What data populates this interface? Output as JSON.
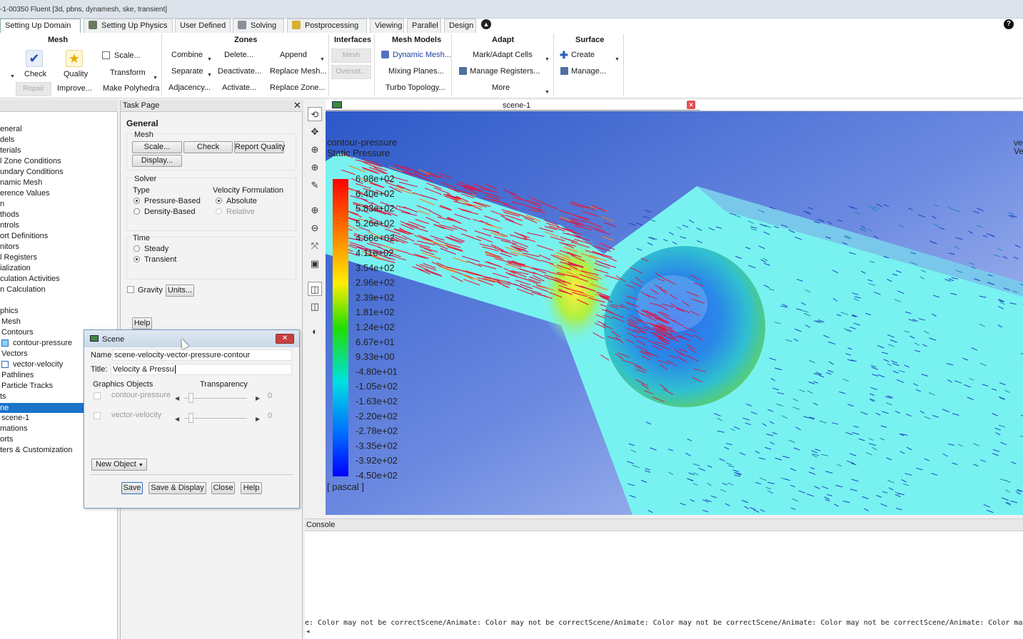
{
  "window": {
    "title": "-1-00350 Fluent  [3d, pbns, dynamesh, ske, transient]"
  },
  "tabs": [
    {
      "label": "Setting Up Domain"
    },
    {
      "label": "Setting Up Physics"
    },
    {
      "label": "User Defined"
    },
    {
      "label": "Solving"
    },
    {
      "label": "Postprocessing"
    },
    {
      "label": "Viewing"
    },
    {
      "label": "Parallel"
    },
    {
      "label": "Design"
    }
  ],
  "ribbon": {
    "mesh": {
      "title": "Mesh",
      "scale": "Scale...",
      "check": "Check",
      "quality": "Quality",
      "transform": "Transform",
      "repair": "Repair",
      "improve": "Improve...",
      "make_polyhedra": "Make Polyhedra"
    },
    "zones": {
      "title": "Zones",
      "combine": "Combine",
      "delete": "Delete...",
      "append": "Append",
      "separate": "Separate",
      "deactivate": "Deactivate...",
      "replace_mesh": "Replace Mesh...",
      "adjacency": "Adjacency...",
      "activate": "Activate...",
      "replace_zone": "Replace Zone..."
    },
    "interfaces": {
      "title": "Interfaces",
      "mesh": "Mesh",
      "overset": "Overset..."
    },
    "mesh_models": {
      "title": "Mesh Models",
      "dynamic_mesh": "Dynamic Mesh...",
      "mixing_planes": "Mixing Planes...",
      "turbo_topology": "Turbo Topology..."
    },
    "adapt": {
      "title": "Adapt",
      "mark_adapt": "Mark/Adapt Cells",
      "manage_registers": "Manage Registers...",
      "more": "More"
    },
    "surface": {
      "title": "Surface",
      "create": "Create",
      "manage": "Manage..."
    }
  },
  "tree": {
    "items": [
      {
        "label": "eneral"
      },
      {
        "label": "dels"
      },
      {
        "label": "terials"
      },
      {
        "label": "l Zone Conditions"
      },
      {
        "label": "undary Conditions"
      },
      {
        "label": "namic Mesh"
      },
      {
        "label": "erence Values"
      },
      {
        "label": "n"
      },
      {
        "label": "thods"
      },
      {
        "label": "ntrols"
      },
      {
        "label": "ort Definitions"
      },
      {
        "label": "nitors"
      },
      {
        "label": "l Registers"
      },
      {
        "label": "ialization"
      },
      {
        "label": "culation Activities"
      },
      {
        "label": "n Calculation"
      },
      {
        "label": ""
      },
      {
        "label": "phics"
      },
      {
        "label": "Mesh"
      },
      {
        "label": "Contours"
      },
      {
        "label": "contour-pressure"
      },
      {
        "label": "Vectors"
      },
      {
        "label": "vector-velocity"
      },
      {
        "label": "Pathlines"
      },
      {
        "label": "Particle Tracks"
      },
      {
        "label": "ts"
      },
      {
        "label": "ne"
      },
      {
        "label": "scene-1"
      },
      {
        "label": "mations"
      },
      {
        "label": "orts"
      },
      {
        "label": "ters & Customization"
      }
    ]
  },
  "task": {
    "header": "Task Page",
    "general": "General",
    "mesh_label": "Mesh",
    "scale_btn": "Scale...",
    "check_btn": "Check",
    "report_quality_btn": "Report Quality",
    "display_btn": "Display...",
    "solver_label": "Solver",
    "type_label": "Type",
    "pressure_based": "Pressure-Based",
    "density_based": "Density-Based",
    "velocity_formulation": "Velocity Formulation",
    "absolute": "Absolute",
    "relative": "Relative",
    "time_label": "Time",
    "steady": "Steady",
    "transient": "Transient",
    "gravity": "Gravity",
    "units_btn": "Units...",
    "help_btn": "Help"
  },
  "scene_dialog": {
    "title": "Scene",
    "name_label": "Name:",
    "name_value": "scene-velocity-vector-pressure-contour",
    "title_label": "Title:",
    "title_value": "Velocity & Pressu",
    "graphics_objects": "Graphics Objects",
    "transparency": "Transparency",
    "objects": [
      {
        "label": "contour-pressure",
        "value": "0"
      },
      {
        "label": "vector-velocity",
        "value": "0"
      }
    ],
    "new_object": "New Object",
    "save": "Save",
    "save_display": "Save & Display",
    "close": "Close",
    "help": "Help"
  },
  "graphics": {
    "tab_label": "scene-1",
    "contour_name": "contour-pressure",
    "contour_var": "Static Pressure",
    "units": "[ pascal ]",
    "legend": [
      "6.98e+02",
      "6.40e+02",
      "5.83e+02",
      "5.26e+02",
      "4.68e+02",
      "4.11e+02",
      "3.54e+02",
      "2.96e+02",
      "2.39e+02",
      "1.81e+02",
      "1.24e+02",
      "6.67e+01",
      "9.33e+00",
      "-4.80e+01",
      "-1.05e+02",
      "-1.63e+02",
      "-2.20e+02",
      "-2.78e+02",
      "-3.35e+02",
      "-3.92e+02",
      "-4.50e+02"
    ],
    "right_edge_top": "ve",
    "right_edge_bottom": "Ve"
  },
  "console": {
    "label": "Console",
    "text": "e: Color may not be correctScene/Animate: Color may not be correctScene/Animate: Color may not be correctScene/Animate: Color may not be correctScene/Animate: Color may not"
  },
  "colors": {
    "selection": "#1c73c9",
    "field_bg": "#70f0f0",
    "vector": "#e02040"
  }
}
